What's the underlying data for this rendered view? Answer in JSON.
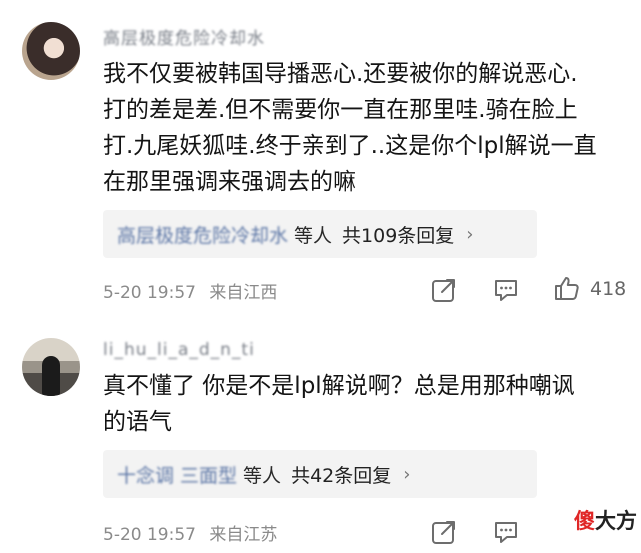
{
  "comments": [
    {
      "username": "高层极度危险冷却水",
      "text": "我不仅要被韩国导播恶心.还要被你的解说恶心.\n打的差是差.但不需要你一直在那里哇.骑在脸上\n打.九尾妖狐哇.终于亲到了..这是你个lpl解说一直\n在那里强调来强调去的嘛",
      "reply_names": "高层极度危险冷却水",
      "reply_suffix": "等人",
      "reply_count_text": "共109条回复",
      "chevron": "›",
      "date": "5-20 19:57",
      "location": "来自江西",
      "likes": "418"
    },
    {
      "username": "li_hu_li_a_d_n_ti",
      "text": "真不懂了 你是不是lpl解说啊？总是用那种嘲讽\n的语气",
      "reply_names": "十念调 三面型",
      "reply_suffix": "等人",
      "reply_count_text": "共42条回复",
      "chevron": "›",
      "date": "5-20 19:57",
      "location": "来自江苏",
      "likes": ""
    }
  ],
  "icons": {
    "share": "share-icon",
    "comment": "comment-icon",
    "like": "thumbs-up-icon"
  },
  "watermark": {
    "char1": "傻",
    "rest": "大方"
  },
  "colors": {
    "link": "#5c76a6",
    "meta": "#8a8a8a",
    "reply_bg": "#f3f3f3",
    "watermark_red": "#e02626"
  }
}
